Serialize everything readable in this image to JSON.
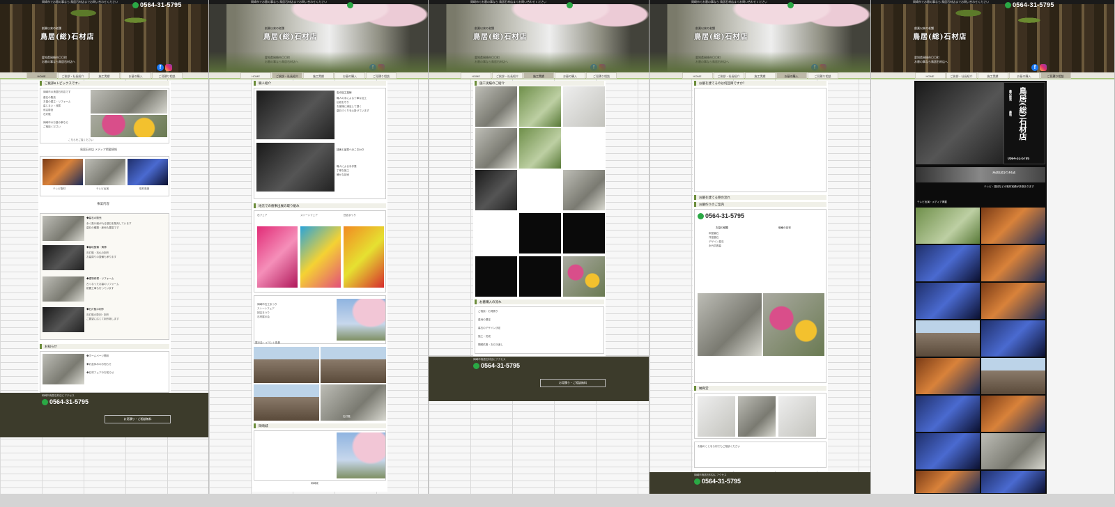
{
  "header": {
    "phone": "0564-31-5795",
    "sub_name": "創業以来の老舗",
    "brand": "鳥居(総)石材店",
    "address": [
      "愛知県岡崎市〇〇町",
      "お墓の事なら鳥居石材店へ"
    ],
    "topline": "岡崎市でお墓の事なら 鳥居石材店までお問い合わせください"
  },
  "nav": [
    "HOME",
    "ご挨拶・社長紹介",
    "施工実績",
    "お墓の購入",
    "ご見積り相談"
  ],
  "panel1": {
    "greeting_head": "ご挨拶&トピックスです♪",
    "greeting_lines": [
      "岡崎市の鳥居石材店です",
      "墓石の販売",
      "お墓の建立・リフォーム",
      "墓じまい・改葬",
      "戒名彫刻",
      "石灯籠",
      "岡崎市のお墓の事なら",
      "ご相談ください"
    ],
    "greeting_caption": "こちらをご覧ください",
    "media_title": "鳥居石材店 メディア掲載情報",
    "tv_labels": [
      "テレビ取材",
      "テレビ出演",
      "取材風景"
    ],
    "services_title": "事業内容",
    "services": [
      {
        "title": "◆墓石の販売",
        "lines": [
          "永く受け継がれる墓石を販売しています",
          "墓石の種類・産地も豊富です"
        ]
      },
      {
        "title": "◆墓地整備・清掃",
        "lines": [
          "石灯籠・石仏の制作",
          "お墓周りの整備も承ります"
        ]
      },
      {
        "title": "◆建物修理・リフォーム",
        "lines": [
          "古くなったお墓のリフォーム",
          "耐震工事も行っています"
        ]
      },
      {
        "title": "◆石灯籠の制作",
        "lines": [
          "石灯籠の彫刻・制作",
          "ご要望に応じて制作致します"
        ]
      }
    ],
    "notice_title": "お知らせ",
    "notice_items": [
      "◆ホームページ開設",
      "◆お盆休みのお知らせ",
      "◆石材フェアのお知らせ"
    ],
    "footer_label": "岡崎市鳥居石材店にアクセス",
    "footer_phone": "0564-31-5795",
    "footer_btn": "お見積り・ご相談無料"
  },
  "panel2": {
    "section1": "職人紹介",
    "intro_lines": [
      "石の加工技術",
      "職人の手による丁寧な加工",
      "伝統を守り",
      "お客様に満足して頂く",
      "墓石づくりを心掛けています"
    ],
    "sub_title": "技術と品質へのこだわり",
    "checks": [
      "職人による手作業",
      "丁寧な施工",
      "確かな技術"
    ],
    "section2": "地元での催事出展の取り組み",
    "posters": [
      "石フェア",
      "ストーンフェア",
      "団吉まつり"
    ],
    "event_list": [
      "岡崎市石工まつり",
      "ストーンフェア",
      "団吉まつり",
      "石材展示会"
    ],
    "section3": "展示会・イベント風景",
    "section4": "岡崎城",
    "foot_note": "岡崎城",
    "panel_caption": "石灯籠"
  },
  "panel3": {
    "section1": "施工実績のご紹介",
    "section2": "お墓購入の流れ",
    "flow_lines": [
      "ご相談・お見積り",
      "墓地の選定",
      "墓石のデザイン決定",
      "施工・完成",
      "開眼供養・お引き渡し"
    ],
    "footer_phone": "0564-31-5795",
    "footer_btn": "お見積り・ご相談無料",
    "footer_label": "岡崎市鳥居石材店にアクセス"
  },
  "panel4": {
    "section1": "お墓を建てるのは何回目ですか？",
    "section2": "お墓を建てる際の流れ",
    "section3": "お墓作りのご案内",
    "phone": "0564-31-5795",
    "table_heads": [
      "お墓の種類",
      "価格の目安"
    ],
    "table_rows": [
      "和型墓石",
      "洋型墓石",
      "デザイン墓石",
      "永代供養墓"
    ],
    "section4": "納骨堂",
    "note": "お墓のことなら何でもご相談ください",
    "footer_phone": "0564-31-5795",
    "footer_label": "岡崎市鳥居石材店にアクセス"
  },
  "panel5": {
    "sign_brand": "鳥居(総)石材店",
    "sign_phone": "0564-31-5795",
    "sign_lines": [
      "墓石販売",
      "墓地",
      "石灯籠",
      "建物修理"
    ],
    "side_text": "テレビ・雑誌などの取材実績が多数あります",
    "media_head": "テレビ出演・メディア掲載",
    "banner": "鳥居(総)石材店"
  }
}
